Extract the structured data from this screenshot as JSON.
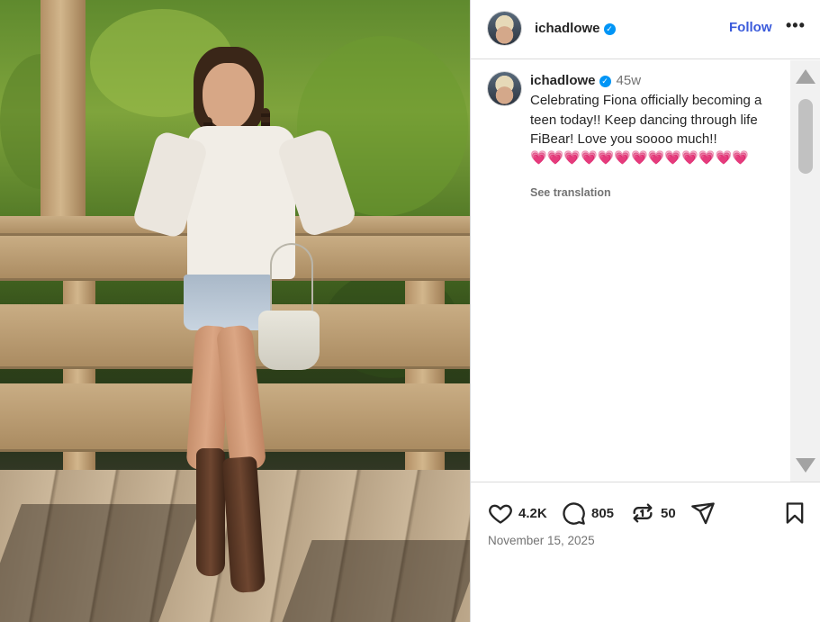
{
  "post": {
    "username": "ichadlowe",
    "verified_mark": "✓",
    "follow_label": "Follow",
    "more_label": "•••",
    "caption": {
      "username": "ichadlowe",
      "age": "45w",
      "text": "Celebrating Fiona officially becoming a teen today!! Keep dancing through life FiBear! Love you soooo much!!",
      "hearts": "💗💗💗💗💗💗💗💗💗💗💗💗💗",
      "see_translation": "See translation"
    },
    "actions": {
      "likes": "4.2K",
      "comments": "805",
      "reposts": "50"
    },
    "date": "November 15, 2025"
  },
  "icons": [
    "heart-icon",
    "comment-icon",
    "repost-icon",
    "share-icon",
    "bookmark-icon",
    "verified-icon",
    "more-icon"
  ],
  "colors": {
    "follow": "#3b5bdb",
    "verified": "#0095f6",
    "heart": "#e8356d",
    "muted": "#737373"
  }
}
